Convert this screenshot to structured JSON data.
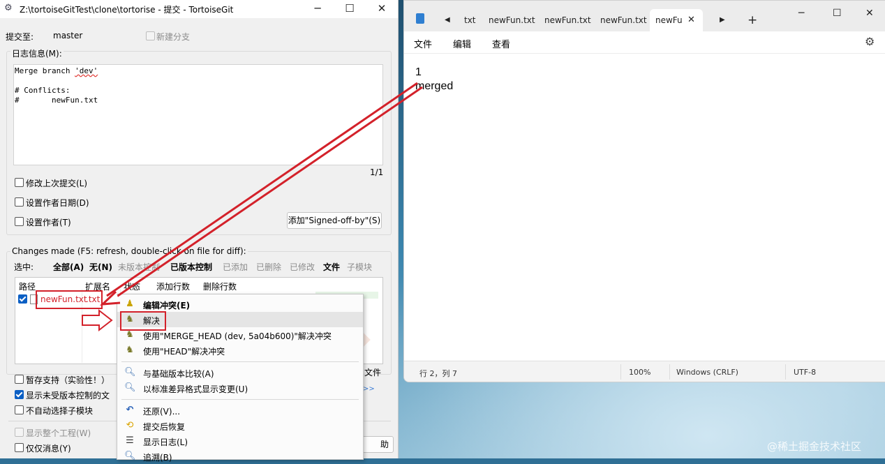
{
  "tortoise": {
    "title": "Z:\\tortoiseGitTest\\clone\\tortorise - 提交 - TortoiseGit",
    "minimize": "─",
    "maximize": "☐",
    "close": "✕",
    "commit_to_label": "提交至:",
    "branch": "master",
    "new_branch_label": "新建分支",
    "log_message_label": "日志信息(M):",
    "message_lines": [
      "Merge branch ",
      "'dev'",
      "# Conflicts:",
      "#       newFun.txt"
    ],
    "position_counter": "1/1",
    "amend_label": "修改上次提交(L)",
    "set_author_date_label": "设置作者日期(D)",
    "set_author_label": "设置作者(T)",
    "signed_off_button": "添加\"Signed-off-by\"(S)",
    "changes_label": "Changes made (F5: refresh, double-click on file for diff):",
    "select_label": "选中:",
    "filters": {
      "all": "全部(A)",
      "none": "无(N)",
      "unversioned": "未版本控制",
      "versioned": "已版本控制",
      "added": "已添加",
      "deleted": "已删除",
      "modified": "已修改",
      "files": "文件",
      "submodules": "子模块"
    },
    "columns": [
      "路径",
      "扩展名",
      "状态",
      "添加行数",
      "删除行数"
    ],
    "file_row": {
      "name": "newFun.txt",
      "ext": ".txt"
    },
    "right_clip_text": "文件",
    "right_clip_link": ">>",
    "stash_label": "暂存支持（实验性！）",
    "show_unversioned_label": "显示未受版本控制的文",
    "no_auto_submodule_label": "不自动选择子模块",
    "show_whole_project_label": "显示整个工程(W)",
    "message_only_label": "仅仅消息(Y)",
    "ok_button_partial": "助"
  },
  "context_menu": {
    "items": [
      {
        "label": "编辑冲突(E)",
        "icon": "tortoise-edit-conflict-icon"
      },
      {
        "label": "解决",
        "icon": "tortoise-resolve-icon"
      },
      {
        "label": "使用\"MERGE_HEAD (dev, 5a04b600)\"解决冲突",
        "icon": "tortoise-resolve-theirs-icon"
      },
      {
        "label": "使用\"HEAD\"解决冲突",
        "icon": "tortoise-resolve-mine-icon"
      },
      {
        "label": "与基础版本比较(A)",
        "icon": "magnifier-icon"
      },
      {
        "label": "以标准差异格式显示变更(U)",
        "icon": "magnifier-icon"
      },
      {
        "label": "还原(V)...",
        "icon": "undo-icon"
      },
      {
        "label": "提交后恢复",
        "icon": "restore-icon"
      },
      {
        "label": "显示日志(L)",
        "icon": "log-icon"
      },
      {
        "label": "追溯(B)",
        "icon": "blame-icon"
      }
    ]
  },
  "notepad": {
    "tabs": [
      "txt",
      "newFun.txt",
      "newFun.txt",
      "newFun.txt",
      "newFu"
    ],
    "new_tab": "+",
    "menus": [
      "文件",
      "编辑",
      "查看"
    ],
    "content_lines": [
      "1",
      "merged"
    ],
    "status": {
      "position": "行 2，列 7",
      "zoom": "100%",
      "line_ending": "Windows (CRLF)",
      "encoding": "UTF-8"
    }
  },
  "watermark": "@稀土掘金技术社区",
  "colors": {
    "highlight_red": "#d3212a",
    "checkbox_blue": "#0b5fc4"
  }
}
